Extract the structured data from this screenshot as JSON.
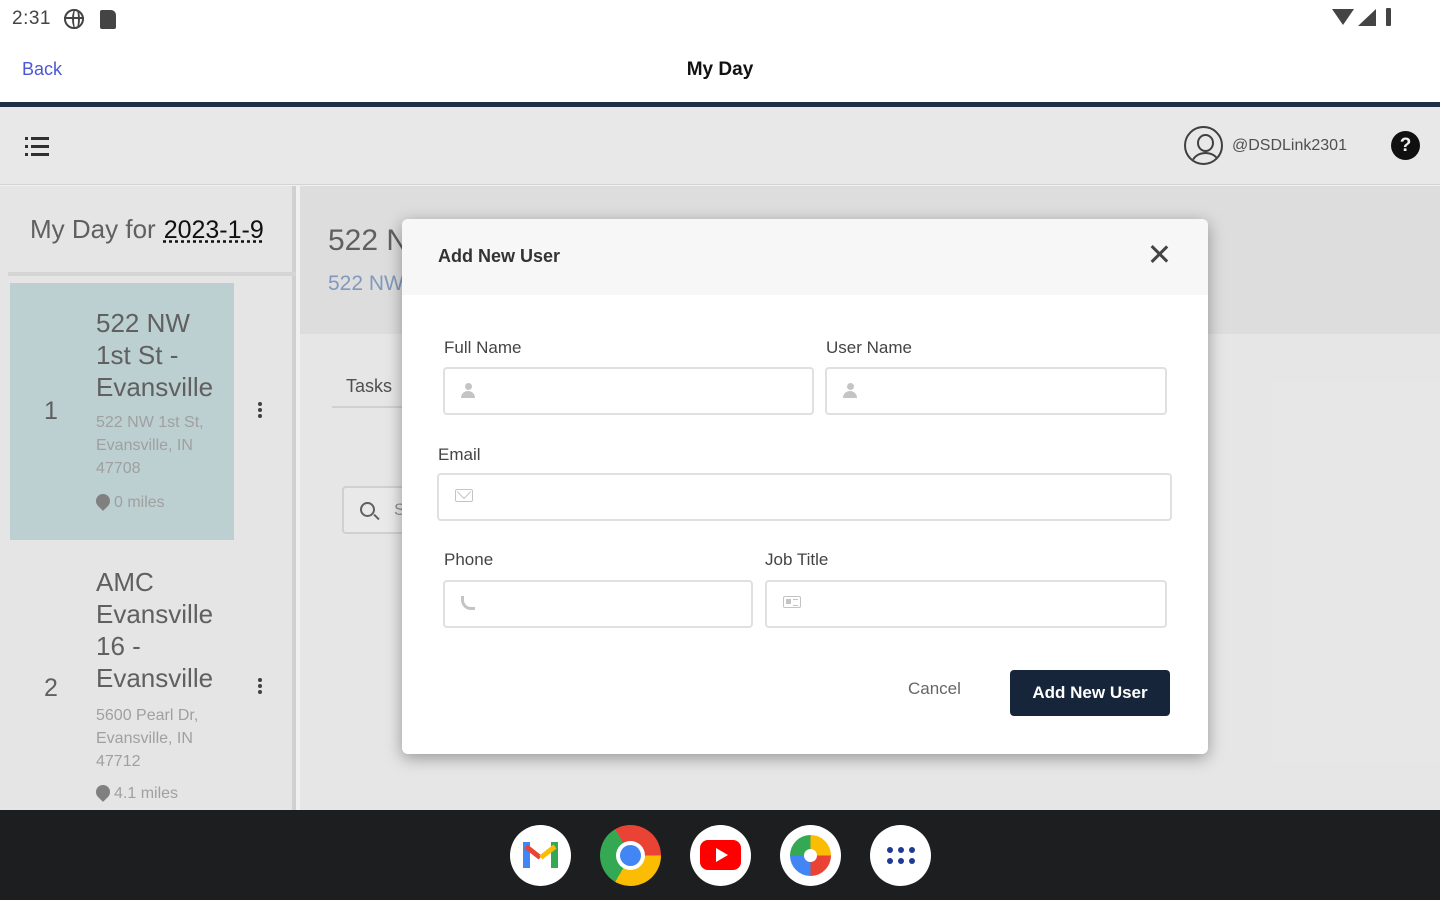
{
  "status_bar": {
    "time": "2:31"
  },
  "header": {
    "back_label": "Back",
    "title": "My Day"
  },
  "toolbar": {
    "user_handle": "@DSDLink2301",
    "help_symbol": "?"
  },
  "sidebar": {
    "my_day_label": "My Day for",
    "date": "2023-1-9",
    "stops": [
      {
        "number": "1",
        "name": "522 NW 1st St - Evansville",
        "address": "522 NW 1st St, Evansville, IN 47708",
        "distance": "0 miles",
        "selected": true
      },
      {
        "number": "2",
        "name": "AMC Evansville 16 - Evansville",
        "address": "5600 Pearl Dr, Evansville, IN 47712",
        "distance": "4.1 miles",
        "selected": false
      }
    ]
  },
  "main": {
    "title": "522 N",
    "subtitle": "522 NW",
    "tab_tasks": "Tasks",
    "search_placeholder": "S"
  },
  "modal": {
    "title": "Add New User",
    "fields": {
      "full_name": {
        "label": "Full Name",
        "value": "",
        "icon": "user-icon"
      },
      "user_name": {
        "label": "User Name",
        "value": "",
        "icon": "user-icon"
      },
      "email": {
        "label": "Email",
        "value": "",
        "icon": "envelope-icon"
      },
      "phone": {
        "label": "Phone",
        "value": "",
        "icon": "phone-icon"
      },
      "job_title": {
        "label": "Job Title",
        "value": "",
        "icon": "id-card-icon"
      }
    },
    "cancel_label": "Cancel",
    "submit_label": "Add New User"
  },
  "taskbar": {
    "apps": [
      "Gmail",
      "Chrome",
      "YouTube",
      "Photos",
      "App launcher"
    ]
  },
  "colors": {
    "primary_dark": "#17253a",
    "header_rule": "#1e2f47",
    "link": "#4a57d6",
    "selected_card": "#c8dcdf"
  }
}
